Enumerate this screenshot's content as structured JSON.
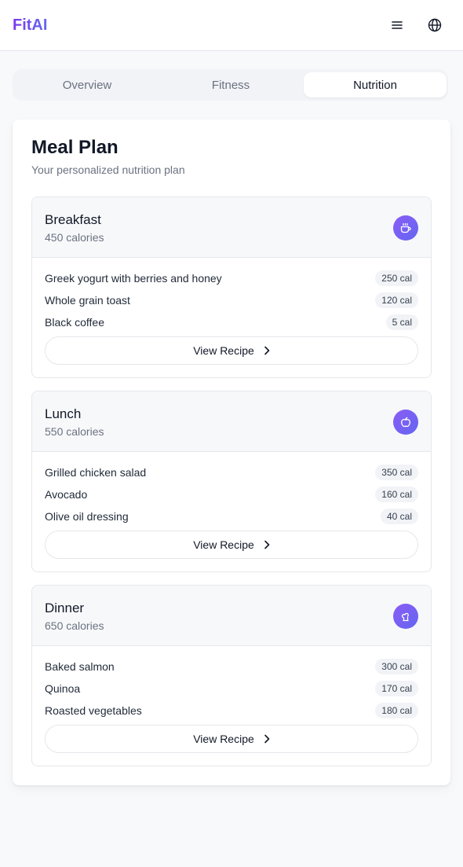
{
  "app": {
    "logo": "FitAI"
  },
  "header": {
    "menu_icon": "menu-icon",
    "language_icon": "globe-icon"
  },
  "tabs": [
    {
      "label": "Overview",
      "active": false
    },
    {
      "label": "Fitness",
      "active": false
    },
    {
      "label": "Nutrition",
      "active": true
    }
  ],
  "meal_plan": {
    "title": "Meal Plan",
    "subtitle": "Your personalized nutrition plan",
    "meals": [
      {
        "name": "Breakfast",
        "calories": "450 calories",
        "icon": "coffee-icon",
        "items": [
          {
            "name": "Greek yogurt with berries and honey",
            "cal": "250 cal"
          },
          {
            "name": "Whole grain toast",
            "cal": "120 cal"
          },
          {
            "name": "Black coffee",
            "cal": "5 cal"
          }
        ],
        "button_label": "View Recipe"
      },
      {
        "name": "Lunch",
        "calories": "550 calories",
        "icon": "apple-icon",
        "items": [
          {
            "name": "Grilled chicken salad",
            "cal": "350 cal"
          },
          {
            "name": "Avocado",
            "cal": "160 cal"
          },
          {
            "name": "Olive oil dressing",
            "cal": "40 cal"
          }
        ],
        "button_label": "View Recipe"
      },
      {
        "name": "Dinner",
        "calories": "650 calories",
        "icon": "chef-hat-icon",
        "items": [
          {
            "name": "Baked salmon",
            "cal": "300 cal"
          },
          {
            "name": "Quinoa",
            "cal": "170 cal"
          },
          {
            "name": "Roasted vegetables",
            "cal": "180 cal"
          }
        ],
        "button_label": "View Recipe"
      }
    ]
  },
  "colors": {
    "accent_start": "#8b5cf6",
    "accent_end": "#6366f1",
    "background": "#f8f9fb"
  }
}
